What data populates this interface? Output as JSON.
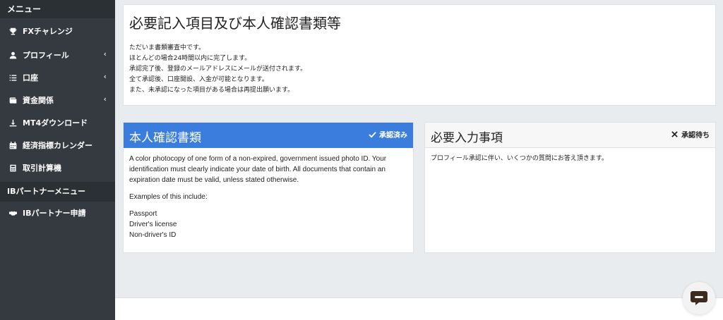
{
  "sidebar": {
    "menu_header": "メニュー",
    "items": [
      {
        "label": "FXチャレンジ",
        "icon": "trophy-icon"
      },
      {
        "label": "プロフィール",
        "icon": "user-icon",
        "chevron": "‹"
      },
      {
        "label": "口座",
        "icon": "list-icon",
        "chevron": "‹"
      },
      {
        "label": "資金関係",
        "icon": "wallet-icon",
        "chevron": "‹"
      },
      {
        "label": "MT4ダウンロード",
        "icon": "download-icon"
      },
      {
        "label": "経済指標カレンダー",
        "icon": "calendar-icon"
      },
      {
        "label": "取引計算機",
        "icon": "calculator-icon"
      }
    ],
    "ib_header": "IBパートナーメニュー",
    "ib_items": [
      {
        "label": "IBパートナー申請",
        "icon": "handshake-icon"
      }
    ]
  },
  "notice": {
    "title": "必要記入項目及び本人確認書類等",
    "lines": [
      "ただいま書類審査中です。",
      "ほとんどの場合24時間以内に完了します。",
      "承認完了後、登録のメールアドレスにメールが送付されます。",
      "全て承認後、口座開設、入金が可能となります。",
      "また、未承認になった項目がある場合は再提出願います。"
    ]
  },
  "identity_card": {
    "title": "本人確認書類",
    "status": "承認済み",
    "status_icon": "check-icon",
    "description": "A color photocopy of one form of a non-expired, government issued photo ID. Your identification must clearly indicate your date of birth. All documents that contain an expiration date must be valid, unless stated otherwise.",
    "examples_heading": "Examples of this include:",
    "examples": [
      "Passport",
      "Driver's license",
      "Non-driver's ID"
    ],
    "accent_color": "#3b7ddd"
  },
  "required_card": {
    "title": "必要入力事項",
    "status": "承認待ち",
    "status_icon": "close-icon",
    "description": "プロフィール承認に伴い、いくつかの質問にお答え頂きます。"
  },
  "chat": {
    "icon": "chat-icon"
  }
}
